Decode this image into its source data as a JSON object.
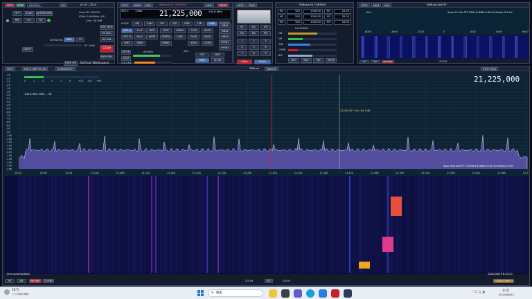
{
  "colors": {
    "accent": "#3f6fb0",
    "red": "#c8202a",
    "spectrum_fill": "#6a5fb8",
    "waterfall_bg": "#0c0f3a"
  },
  "top_status": {
    "sets": "SETS",
    "run": "RUN",
    "dev": "RSP2PRO",
    "rate": "RX",
    "time": "01:47 / 2024"
  },
  "left_panel": {
    "btn_opt": "OPT",
    "btn_scan": "SCAN",
    "btn_sig": "SIG/RECORD",
    "btn_ref": "REF",
    "btn_ifs": "IFS",
    "btn_rx": "RX",
    "rx_label": "REF",
    "rate_label": "Final SR:  200000",
    "if_label": "IFBW:  0.600MHz (LIF)",
    "gain_label": "Gain: 36.0dB",
    "agc_label": "AGC  MED",
    "btn_rf_lo": "RF AGC",
    "btn_hi": "HI LOW",
    "btn_ant": "ANT",
    "network": "NETWORK",
    "rf_gain": "RF GAIN",
    "btn_stop": "STOP",
    "btn_memo": "MEM FAV",
    "btn_save": "SAVE",
    "btn_ws": "SAVE WS",
    "btn_lo": "LO",
    "workspace": "Default Workspace",
    "btn_gain": "GAIN+"
  },
  "rx_panel": {
    "title": "SDRuno RX CONTROL",
    "tab_sets": "SETS",
    "tab_mem": "MEMO",
    "tab_dsp": "DSP",
    "tab_save": "SAVE",
    "tab_mute": "MUTE",
    "vfo_small": "VFO 1",
    "freq": "21,225,000",
    "freq_step": "1 KHz",
    "rssi": "-100.8 dBm",
    "mode_label": "MODE",
    "modes": [
      "AM",
      "SAM",
      "FM",
      "CW",
      "DSB",
      "LSB",
      "USB",
      "DIGITAL"
    ],
    "row1": [
      "VFO A",
      "A>B",
      "NFM",
      "MFM",
      "CWPN",
      "1200",
      "6000"
    ],
    "row2": [
      "VFO B",
      "B>A",
      "WFM",
      "SWFM",
      "CWR",
      "2400",
      "9000"
    ],
    "row3": [
      "QMS",
      "QMN",
      "",
      "CWNC",
      "",
      "3000",
      "12000"
    ],
    "btn_mute": "MUTE",
    "btn_sqlt": "SQLT",
    "volume": "VOLUME",
    "squelch": "-84 dBm",
    "agc_label": "AGC",
    "agc_vals": [
      "OFF",
      "FAST",
      "MED",
      "SLOW"
    ],
    "nr": "NR",
    "nb": "NB",
    "notch": "NOTCH",
    "nbx": [
      "NBX1",
      "NBX2",
      "NBX3",
      "MON1",
      "MON2"
    ]
  },
  "ml_panel": {
    "title": "MEMO",
    "tab1": "SETS",
    "tab2": "TCXO",
    "btn_clear": "Clear",
    "btn_enter": "Enter",
    "keys": [
      "1",
      "2",
      "3",
      "4",
      "5",
      "6",
      "7",
      "8",
      "9",
      ".",
      "0",
      "K"
    ],
    "km": [
      "K1",
      "K2",
      "K3",
      "M1",
      "M2",
      "M3"
    ]
  },
  "rf_panel": {
    "title": "SDRuno RX CONTROL",
    "hdr": [
      "IN",
      "FREQ",
      "OUT",
      "FREQ"
    ],
    "rows": [
      [
        "M1",
        "500",
        "1000.00",
        "M1",
        "20.00"
      ],
      [
        "M2",
        "500",
        "1000.00",
        "M2",
        "20.00"
      ],
      [
        "M3",
        "500",
        "1000.00",
        "M3",
        "20.00"
      ]
    ],
    "band_label": "RX SIGNAL",
    "labels": [
      "NB",
      "NR",
      "ANF",
      "CWPK",
      "BW"
    ],
    "nb_btns": [
      "BFC",
      "AGC",
      "NR",
      "MUTE"
    ],
    "nr_val": "10",
    "bw": "50"
  },
  "aux_panel": {
    "tab_sets": "SETS",
    "tab_mem": "MEM",
    "tab_aux": "AUX",
    "title": "SDRuno AUX SP",
    "span": "Span 12 kHz  FFT 628 Hz  RBW 9.66 Hz  Marks 200 Hz",
    "ticks": [
      "-6000",
      "-4000",
      "-2000",
      "0",
      "2000",
      "4000",
      "6000"
    ],
    "db": "dBm",
    "btn_sp": "SP",
    "btn_wf": "WF",
    "btn_sp2": "SP+WF",
    "zoom": "ZOOM"
  },
  "main": {
    "btn_sets": "SETS",
    "btn_pan": "PAN & SNR TO CW",
    "btn_scr": "SCREENSHOT",
    "title": "SDRuno",
    "subtitle": "MAIN SP",
    "stop_lock": "STOP LOCK",
    "freq": "21,225,000",
    "db_labels": [
      "-10",
      "-15",
      "-20",
      "-25",
      "-30",
      "-35",
      "-40",
      "-45",
      "-50",
      "-55",
      "-60",
      "-65",
      "-70",
      "-75",
      "-80",
      "-85",
      "-90",
      "-95",
      "-100",
      "-105",
      "-110",
      "-115",
      "-120",
      "-125",
      "-130",
      "-135",
      "-140",
      "-145",
      "-150"
    ],
    "snr_line": "-106.6 dBm  SNR: -- dB",
    "smeter": [
      "S",
      "1",
      "3",
      "5",
      "7",
      "9",
      "+20",
      "+40",
      "+60"
    ],
    "marker": "21290.437 kHz  -69.3 dB",
    "freq_ticks": [
      "20.90",
      "20.96",
      "21.00",
      "21.040",
      "21.080",
      "21.120",
      "21.160",
      "21.200",
      "21.240",
      "21.280",
      "21.300",
      "21.340",
      "21.380",
      "21.420",
      "21.460",
      "21.500",
      "21.540",
      "21.580",
      "21.620",
      "21.660",
      "21.700"
    ],
    "span_info": "Span 900 kHz   FFT 32768 Hz  RBW 15.26 Hz  Marks 3 kHz",
    "wf_label": "15m band:Isolated",
    "timestamp": "2022/06/23  8:33:20",
    "btn_sp": "SP",
    "btn_wf": "WF",
    "btn_spwf": "SP+WF",
    "btn_combo": "COMBO",
    "zoom": "ZOOM",
    "vfo": "VFO",
    "zoom2": "ZOOM",
    "sr": "SQLC  TWC"
  },
  "taskbar": {
    "weather_temp": "26°C",
    "weather_desc": "くもり時々晴れ",
    "search": "検索",
    "time": "8:32",
    "date": "2023/06/23"
  }
}
